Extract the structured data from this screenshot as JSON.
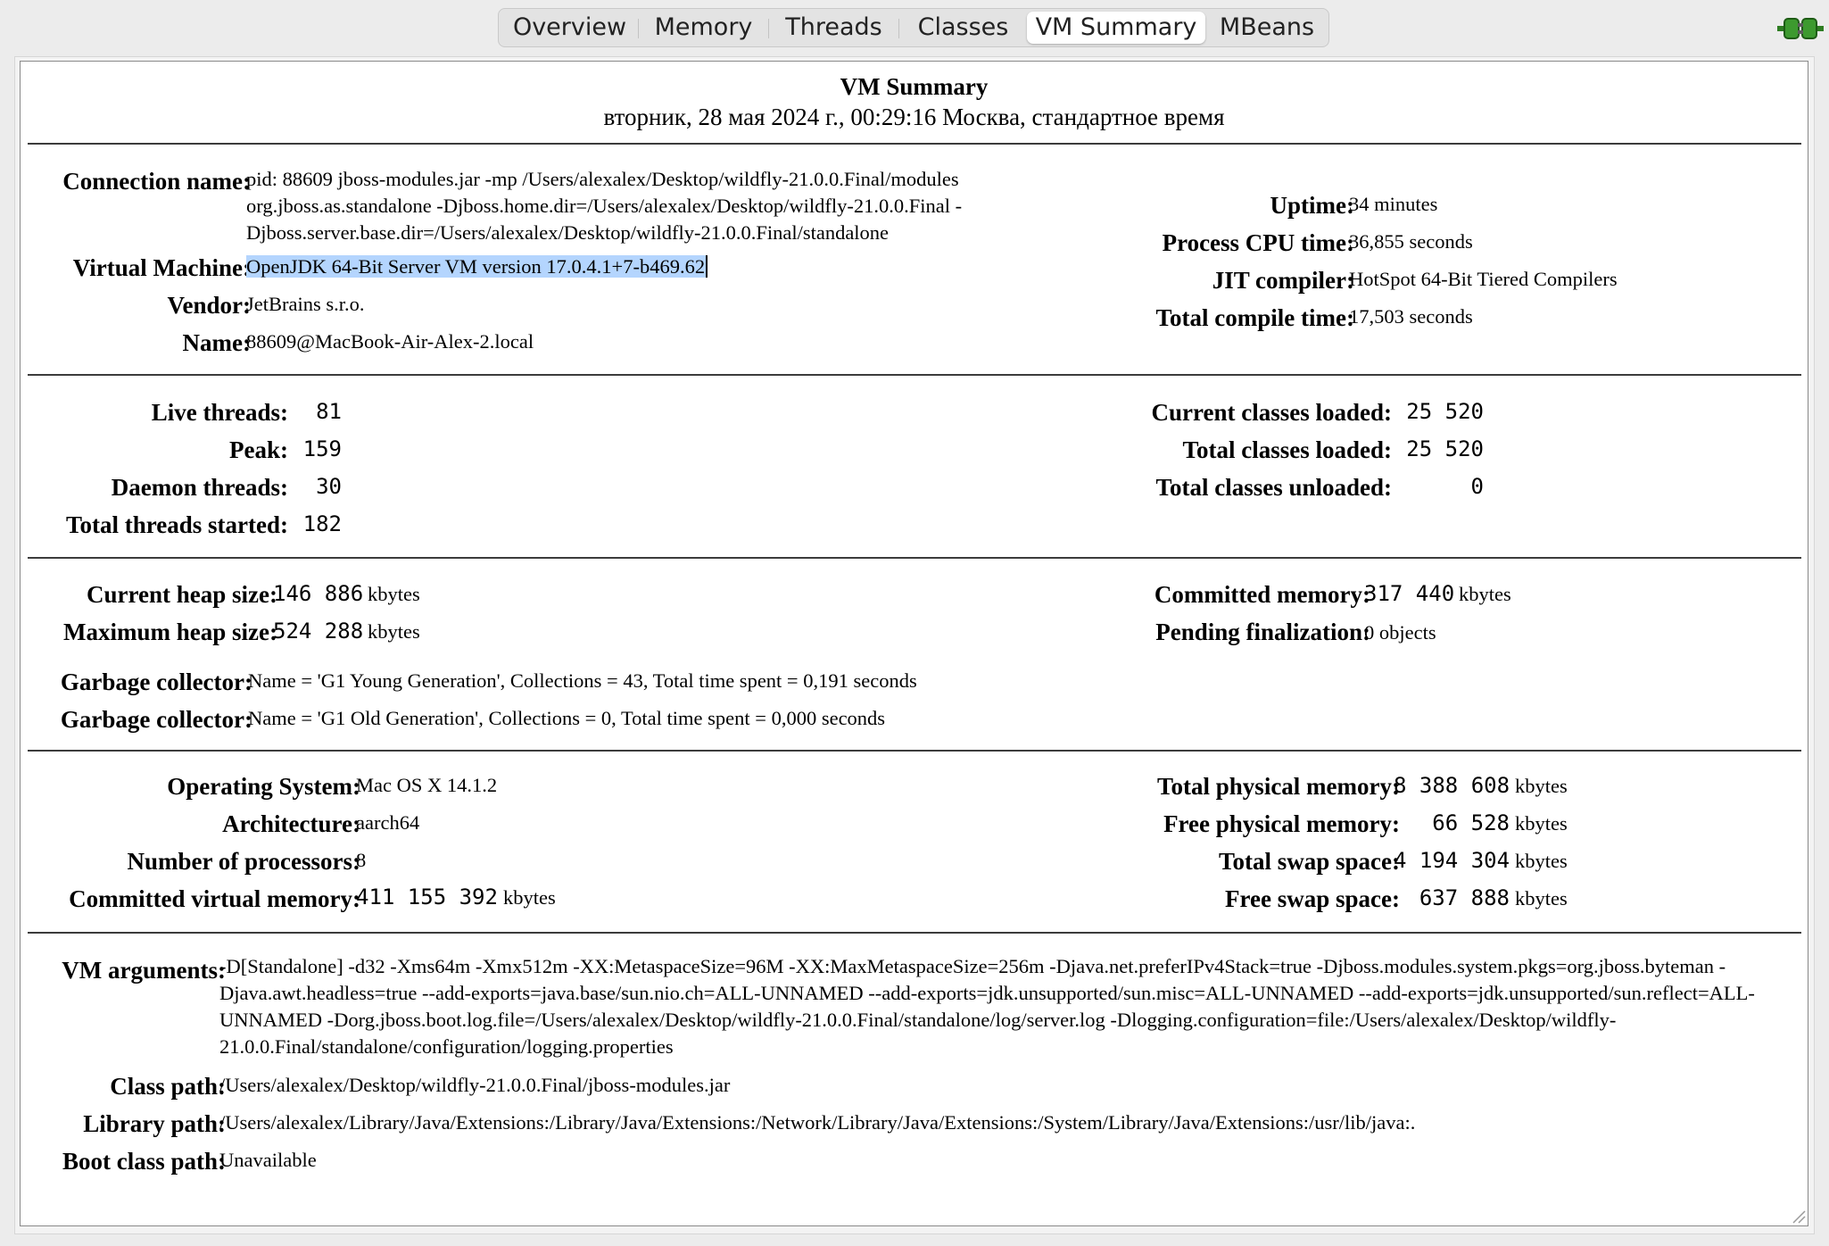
{
  "tabs": [
    "Overview",
    "Memory",
    "Threads",
    "Classes",
    "VM Summary",
    "MBeans"
  ],
  "active_tab": "VM Summary",
  "header": {
    "title": "VM Summary",
    "datetime": "вторник, 28 мая 2024 г., 00:29:16 Москва, стандартное время"
  },
  "vm": {
    "connection_label": "Connection name:",
    "connection_value": "pid: 88609 jboss-modules.jar -mp /Users/alexalex/Desktop/wildfly-21.0.0.Final/modules org.jboss.as.standalone -Djboss.home.dir=/Users/alexalex/Desktop/wildfly-21.0.0.Final -Djboss.server.base.dir=/Users/alexalex/Desktop/wildfly-21.0.0.Final/standalone",
    "virtual_machine_label": "Virtual Machine:",
    "virtual_machine_value": "OpenJDK 64-Bit Server VM version 17.0.4.1+7-b469.62",
    "vendor_label": "Vendor:",
    "vendor_value": "JetBrains s.r.o.",
    "name_label": "Name:",
    "name_value": "88609@MacBook-Air-Alex-2.local",
    "uptime_label": "Uptime:",
    "uptime_value": "34 minutes",
    "cpu_time_label": "Process CPU time:",
    "cpu_time_value": "36,855 seconds",
    "jit_label": "JIT compiler:",
    "jit_value": "HotSpot 64-Bit Tiered Compilers",
    "compile_time_label": "Total compile time:",
    "compile_time_value": "17,503 seconds"
  },
  "threads": {
    "live_label": "Live threads:",
    "live_value": "81",
    "peak_label": "Peak:",
    "peak_value": "159",
    "daemon_label": "Daemon threads:",
    "daemon_value": "30",
    "started_label": "Total threads started:",
    "started_value": "182"
  },
  "classes": {
    "current_label": "Current classes loaded:",
    "current_value": "25 520",
    "total_label": "Total classes loaded:",
    "total_value": "25 520",
    "unloaded_label": "Total classes unloaded:",
    "unloaded_value": "0"
  },
  "memory": {
    "heap_label": "Current heap size:",
    "heap_value": "146 886",
    "heap_unit": "kbytes",
    "max_heap_label": "Maximum heap size:",
    "max_heap_value": "524 288",
    "max_heap_unit": "kbytes",
    "committed_label": "Committed memory:",
    "committed_value": "317 440",
    "committed_unit": "kbytes",
    "pending_label": "Pending finalization:",
    "pending_value": "0 objects",
    "gc": [
      {
        "label": "Garbage collector:",
        "value": "Name = 'G1 Young Generation', Collections = 43, Total time spent = 0,191 seconds"
      },
      {
        "label": "Garbage collector:",
        "value": "Name = 'G1 Old Generation', Collections = 0, Total time spent = 0,000 seconds"
      }
    ]
  },
  "os": {
    "os_label": "Operating System:",
    "os_value": "Mac OS X 14.1.2",
    "arch_label": "Architecture:",
    "arch_value": "aarch64",
    "cpus_label": "Number of processors:",
    "cpus_value": "8",
    "cvm_label": "Committed virtual memory:",
    "cvm_value": "411 155 392",
    "cvm_unit": "kbytes",
    "tpm_label": "Total physical memory:",
    "tpm_value": "8 388 608",
    "tpm_unit": "kbytes",
    "fpm_label": "Free physical memory:",
    "fpm_value": "66 528",
    "fpm_unit": "kbytes",
    "tss_label": "Total swap space:",
    "tss_value": "4 194 304",
    "tss_unit": "kbytes",
    "fss_label": "Free swap space:",
    "fss_value": "637 888",
    "fss_unit": "kbytes"
  },
  "paths": {
    "vm_args_label": "VM arguments:",
    "vm_args_value": "-D[Standalone] -d32 -Xms64m -Xmx512m -XX:MetaspaceSize=96M -XX:MaxMetaspaceSize=256m -Djava.net.preferIPv4Stack=true -Djboss.modules.system.pkgs=org.jboss.byteman -Djava.awt.headless=true --add-exports=java.base/sun.nio.ch=ALL-UNNAMED --add-exports=jdk.unsupported/sun.misc=ALL-UNNAMED --add-exports=jdk.unsupported/sun.reflect=ALL-UNNAMED -Dorg.jboss.boot.log.file=/Users/alexalex/Desktop/wildfly-21.0.0.Final/standalone/log/server.log -Dlogging.configuration=file:/Users/alexalex/Desktop/wildfly-21.0.0.Final/standalone/configuration/logging.properties",
    "class_path_label": "Class path:",
    "class_path_value": "/Users/alexalex/Desktop/wildfly-21.0.0.Final/jboss-modules.jar",
    "library_path_label": "Library path:",
    "library_path_value": "/Users/alexalex/Library/Java/Extensions:/Library/Java/Extensions:/Network/Library/Java/Extensions:/System/Library/Java/Extensions:/usr/lib/java:.",
    "boot_class_path_label": "Boot class path:",
    "boot_class_path_value": "Unavailable"
  },
  "colors": {
    "selection": "#b4d5fe",
    "plug_icon": "#3d9a2f"
  }
}
